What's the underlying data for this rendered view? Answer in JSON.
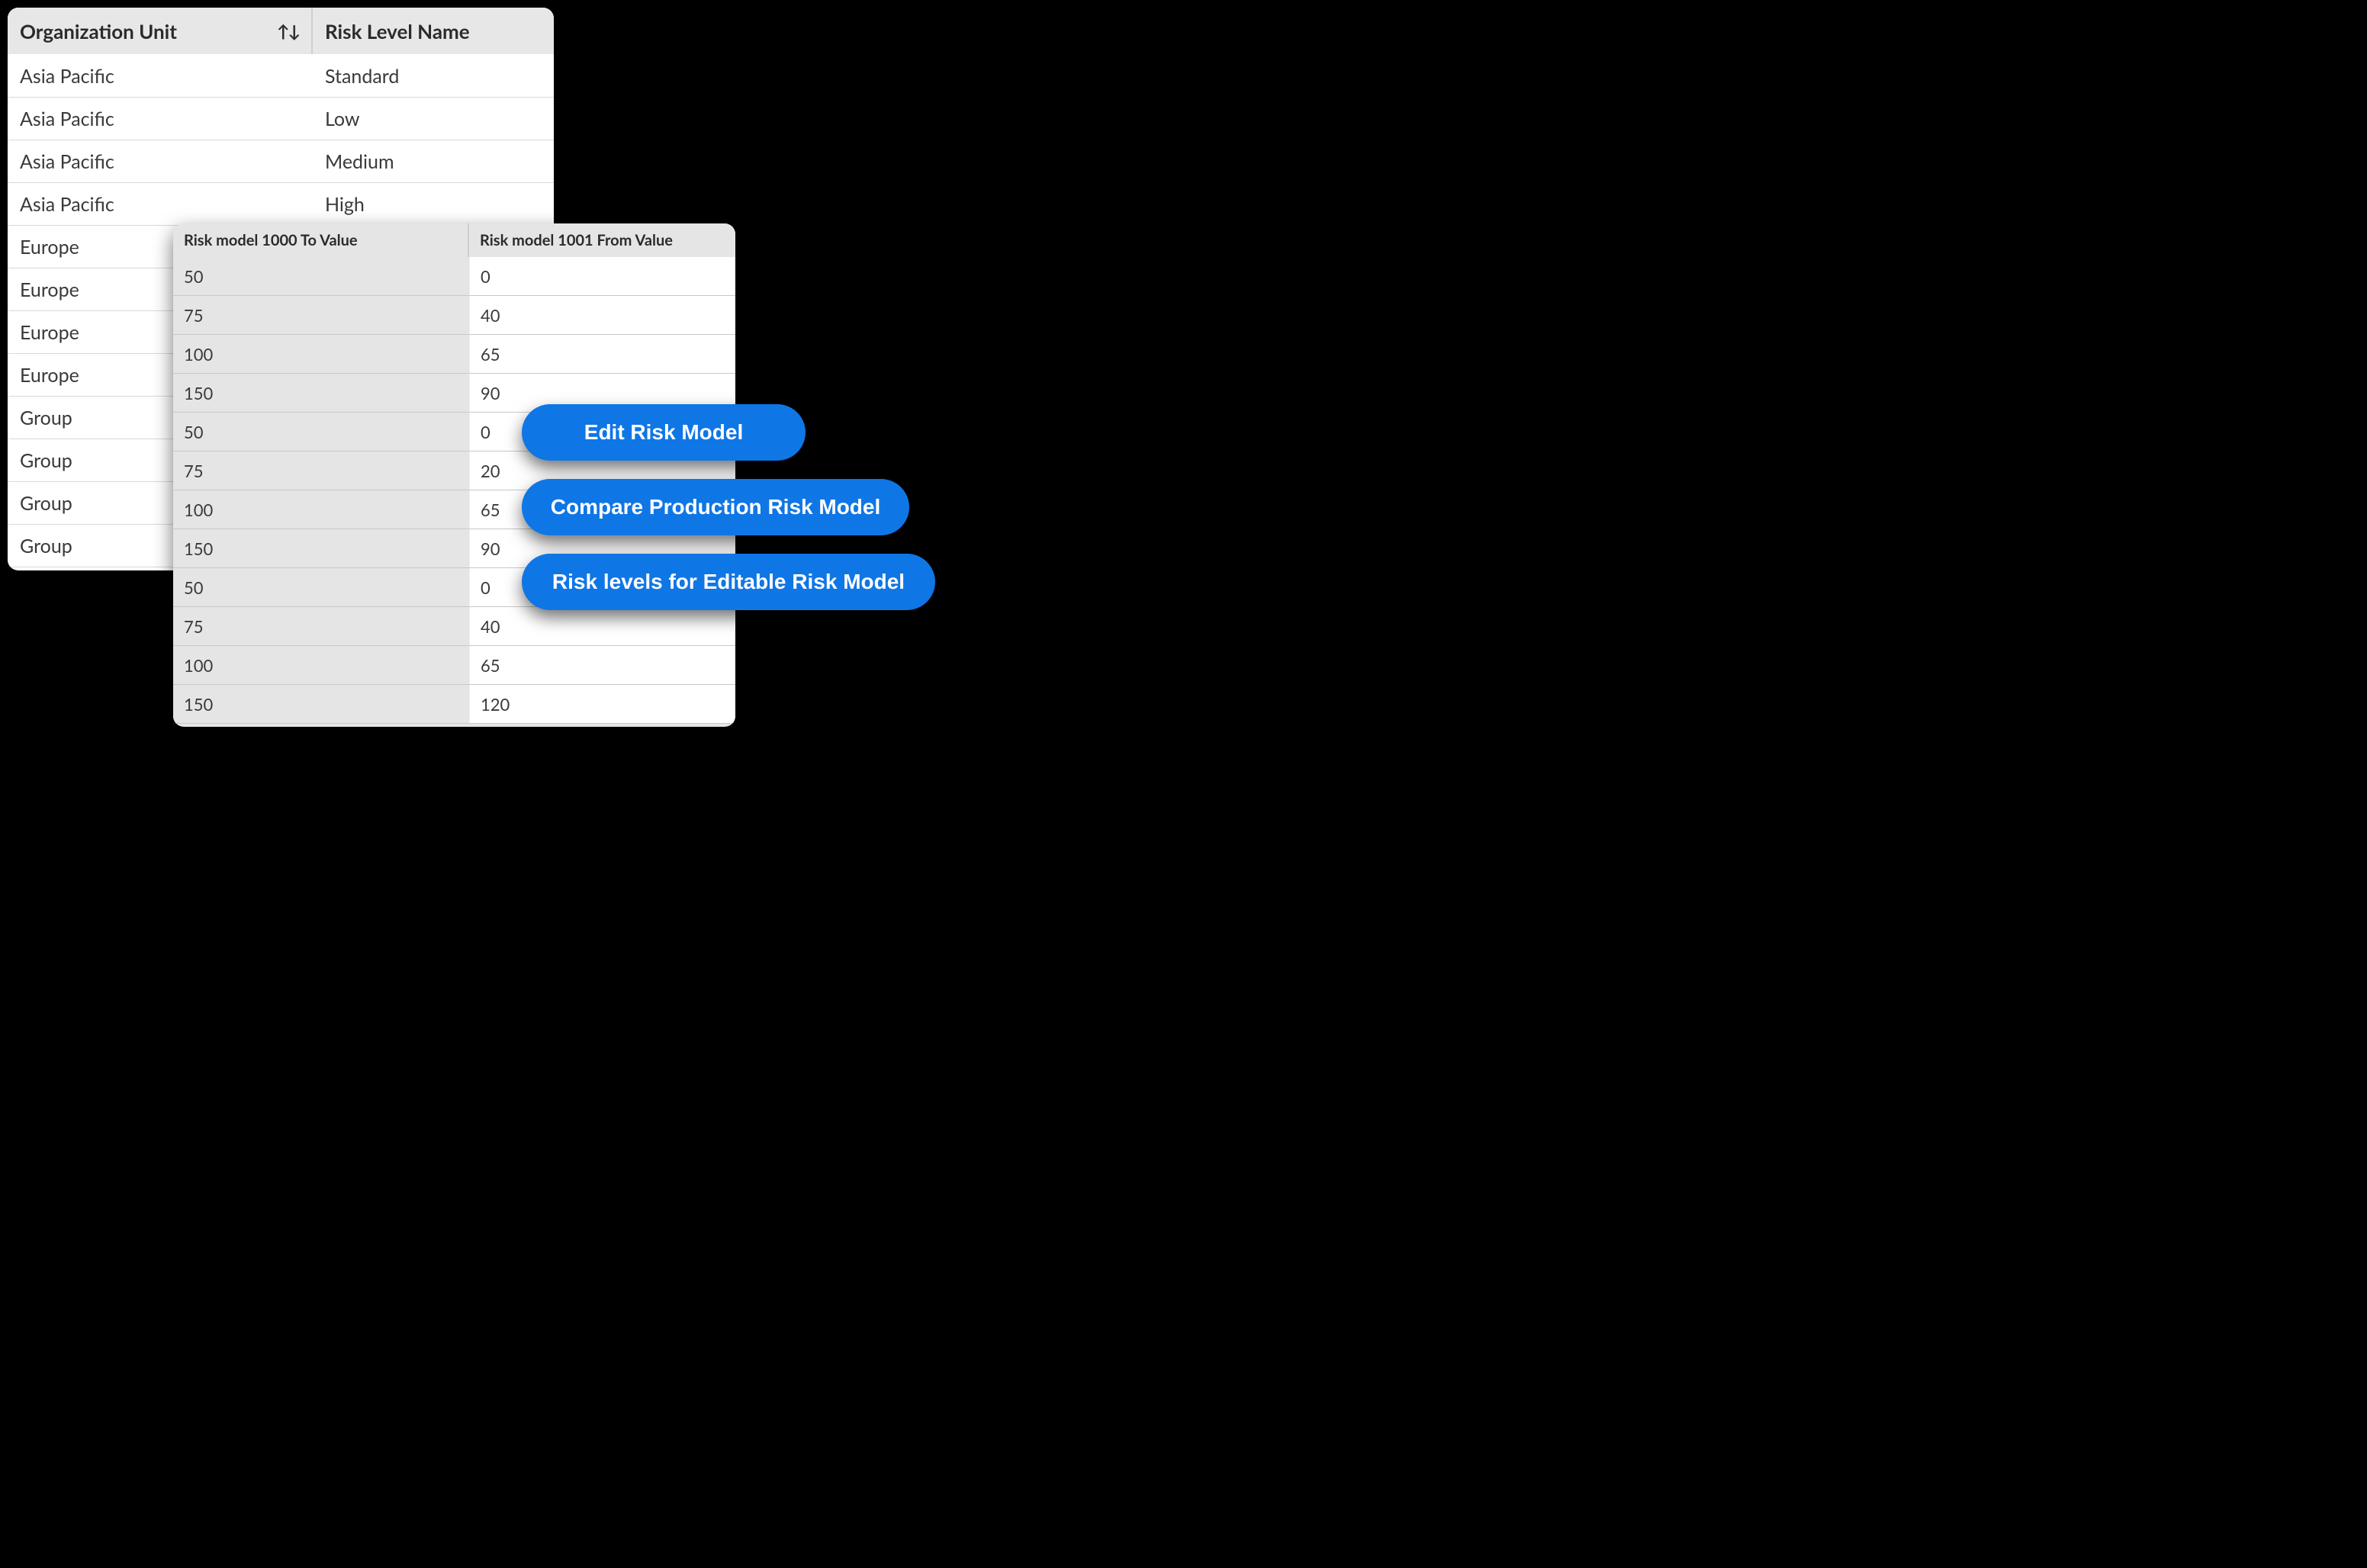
{
  "tableA": {
    "headers": {
      "orgUnit": "Organization Unit",
      "riskLevel": "Risk Level Name"
    },
    "rows": [
      {
        "org": "Asia Pacific",
        "level": "Standard"
      },
      {
        "org": "Asia Pacific",
        "level": "Low"
      },
      {
        "org": "Asia Pacific",
        "level": "Medium"
      },
      {
        "org": "Asia Pacific",
        "level": "High"
      },
      {
        "org": "Europe",
        "level": ""
      },
      {
        "org": "Europe",
        "level": ""
      },
      {
        "org": "Europe",
        "level": ""
      },
      {
        "org": "Europe",
        "level": ""
      },
      {
        "org": "Group",
        "level": ""
      },
      {
        "org": "Group",
        "level": ""
      },
      {
        "org": "Group",
        "level": ""
      },
      {
        "org": "Group",
        "level": ""
      }
    ]
  },
  "tableB": {
    "headers": {
      "toValue": "Risk model 1000 To Value",
      "fromValue": "Risk model 1001 From Value"
    },
    "rows": [
      {
        "to": "50",
        "from": "0"
      },
      {
        "to": "75",
        "from": "40"
      },
      {
        "to": "100",
        "from": "65"
      },
      {
        "to": "150",
        "from": "90"
      },
      {
        "to": "50",
        "from": "0"
      },
      {
        "to": "75",
        "from": "20"
      },
      {
        "to": "100",
        "from": "65"
      },
      {
        "to": "150",
        "from": "90"
      },
      {
        "to": "50",
        "from": "0"
      },
      {
        "to": "75",
        "from": "40"
      },
      {
        "to": "100",
        "from": "65"
      },
      {
        "to": "150",
        "from": "120"
      }
    ]
  },
  "buttons": {
    "edit": "Edit Risk Model",
    "compare": "Compare Production Risk Model",
    "levels": "Risk levels for Editable Risk Model"
  }
}
